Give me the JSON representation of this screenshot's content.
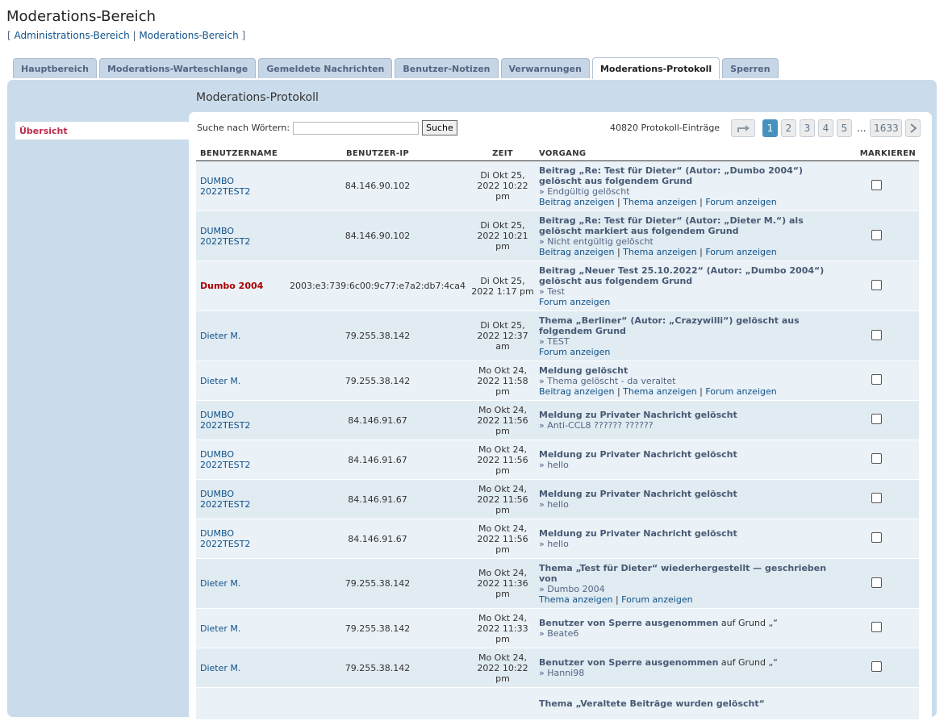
{
  "page_title": "Moderations-Bereich",
  "breadcrumbs": {
    "open": "[",
    "admin": "Administrations-Bereich",
    "sep": "|",
    "mod": "Moderations-Bereich",
    "close": "]"
  },
  "tabs": [
    "Hauptbereich",
    "Moderations-Warteschlange",
    "Gemeldete Nachrichten",
    "Benutzer-Notizen",
    "Verwarnungen",
    "Moderations-Protokoll",
    "Sperren"
  ],
  "active_tab": "Moderations-Protokoll",
  "sidebar": {
    "items": [
      {
        "label": "Übersicht"
      }
    ]
  },
  "section_title": "Moderations-Protokoll",
  "search": {
    "label": "Suche nach Wörtern:",
    "value": "",
    "button": "Suche"
  },
  "entry_count": "40820 Protokoll-Einträge",
  "pagination": {
    "pages": [
      "1",
      "2",
      "3",
      "4",
      "5"
    ],
    "current": "1",
    "ellipsis": "...",
    "last": "1633"
  },
  "columns": {
    "user": "BENUTZERNAME",
    "ip": "BENUTZER-IP",
    "time": "ZEIT",
    "action": "VORGANG",
    "mark": "MARKIEREN"
  },
  "rows": [
    {
      "user": "DUMBO 2022TEST2",
      "user_style": "normal",
      "ip": "84.146.90.102",
      "time": "Di Okt 25, 2022 10:22 pm",
      "title": "Beitrag „Re: Test für Dieter“ (Autor: „Dumbo 2004“) gelöscht aus folgendem Grund",
      "title_extra": "",
      "reason": "» Endgültig gelöscht",
      "links": [
        "Beitrag anzeigen",
        "Thema anzeigen",
        "Forum anzeigen"
      ]
    },
    {
      "user": "DUMBO 2022TEST2",
      "user_style": "normal",
      "ip": "84.146.90.102",
      "time": "Di Okt 25, 2022 10:21 pm",
      "title": "Beitrag „Re: Test für Dieter“ (Autor: „Dieter M.“) als gelöscht markiert aus folgendem Grund",
      "title_extra": "",
      "reason": "» Nicht entgültig gelöscht",
      "links": [
        "Beitrag anzeigen",
        "Thema anzeigen",
        "Forum anzeigen"
      ]
    },
    {
      "user": "Dumbo 2004",
      "user_style": "red",
      "ip": "2003:e3:739:6c00:9c77:e7a2:db7:4ca4",
      "time": "Di Okt 25, 2022 1:17 pm",
      "title": "Beitrag „Neuer Test 25.10.2022“ (Autor: „Dumbo 2004“) gelöscht aus folgendem Grund",
      "title_extra": "",
      "reason": "» Test",
      "links": [
        "Forum anzeigen"
      ]
    },
    {
      "user": "Dieter M.",
      "user_style": "normal",
      "ip": "79.255.38.142",
      "time": "Di Okt 25, 2022 12:37 am",
      "title": "Thema „Berliner“ (Autor: „Crazywilli“) gelöscht aus folgendem Grund",
      "title_extra": "",
      "reason": "» TEST",
      "links": [
        "Forum anzeigen"
      ]
    },
    {
      "user": "Dieter M.",
      "user_style": "normal",
      "ip": "79.255.38.142",
      "time": "Mo Okt 24, 2022 11:58 pm",
      "title": "Meldung gelöscht",
      "title_extra": "",
      "reason": "» Thema gelöscht - da veraltet",
      "links": [
        "Beitrag anzeigen",
        "Thema anzeigen",
        "Forum anzeigen"
      ]
    },
    {
      "user": "DUMBO 2022TEST2",
      "user_style": "normal",
      "ip": "84.146.91.67",
      "time": "Mo Okt 24, 2022 11:56 pm",
      "title": "Meldung zu Privater Nachricht gelöscht",
      "title_extra": "",
      "reason": "» Anti-CCL8 ?????? ??????",
      "links": []
    },
    {
      "user": "DUMBO 2022TEST2",
      "user_style": "normal",
      "ip": "84.146.91.67",
      "time": "Mo Okt 24, 2022 11:56 pm",
      "title": "Meldung zu Privater Nachricht gelöscht",
      "title_extra": "",
      "reason": "» hello",
      "links": []
    },
    {
      "user": "DUMBO 2022TEST2",
      "user_style": "normal",
      "ip": "84.146.91.67",
      "time": "Mo Okt 24, 2022 11:56 pm",
      "title": "Meldung zu Privater Nachricht gelöscht",
      "title_extra": "",
      "reason": "» hello",
      "links": []
    },
    {
      "user": "DUMBO 2022TEST2",
      "user_style": "normal",
      "ip": "84.146.91.67",
      "time": "Mo Okt 24, 2022 11:56 pm",
      "title": "Meldung zu Privater Nachricht gelöscht",
      "title_extra": "",
      "reason": "» hello",
      "links": []
    },
    {
      "user": "Dieter M.",
      "user_style": "normal",
      "ip": "79.255.38.142",
      "time": "Mo Okt 24, 2022 11:36 pm",
      "title": "Thema „Test für Dieter“ wiederhergestellt — geschrieben von",
      "title_extra": "",
      "reason": "» Dumbo 2004",
      "links": [
        "Thema anzeigen",
        "Forum anzeigen"
      ]
    },
    {
      "user": "Dieter M.",
      "user_style": "normal",
      "ip": "79.255.38.142",
      "time": "Mo Okt 24, 2022 11:33 pm",
      "title": "Benutzer von Sperre ausgenommen",
      "title_extra": " auf Grund „“",
      "reason": "» Beate6",
      "links": []
    },
    {
      "user": "Dieter M.",
      "user_style": "normal",
      "ip": "79.255.38.142",
      "time": "Mo Okt 24, 2022 10:22 pm",
      "title": "Benutzer von Sperre ausgenommen",
      "title_extra": " auf Grund „“",
      "reason": "» Hanni98",
      "links": []
    },
    {
      "user": "",
      "user_style": "normal",
      "ip": "",
      "time": "",
      "title": "Thema „Veraltete Beiträge wurden gelöscht“",
      "title_extra": "",
      "reason": "",
      "links": []
    }
  ]
}
